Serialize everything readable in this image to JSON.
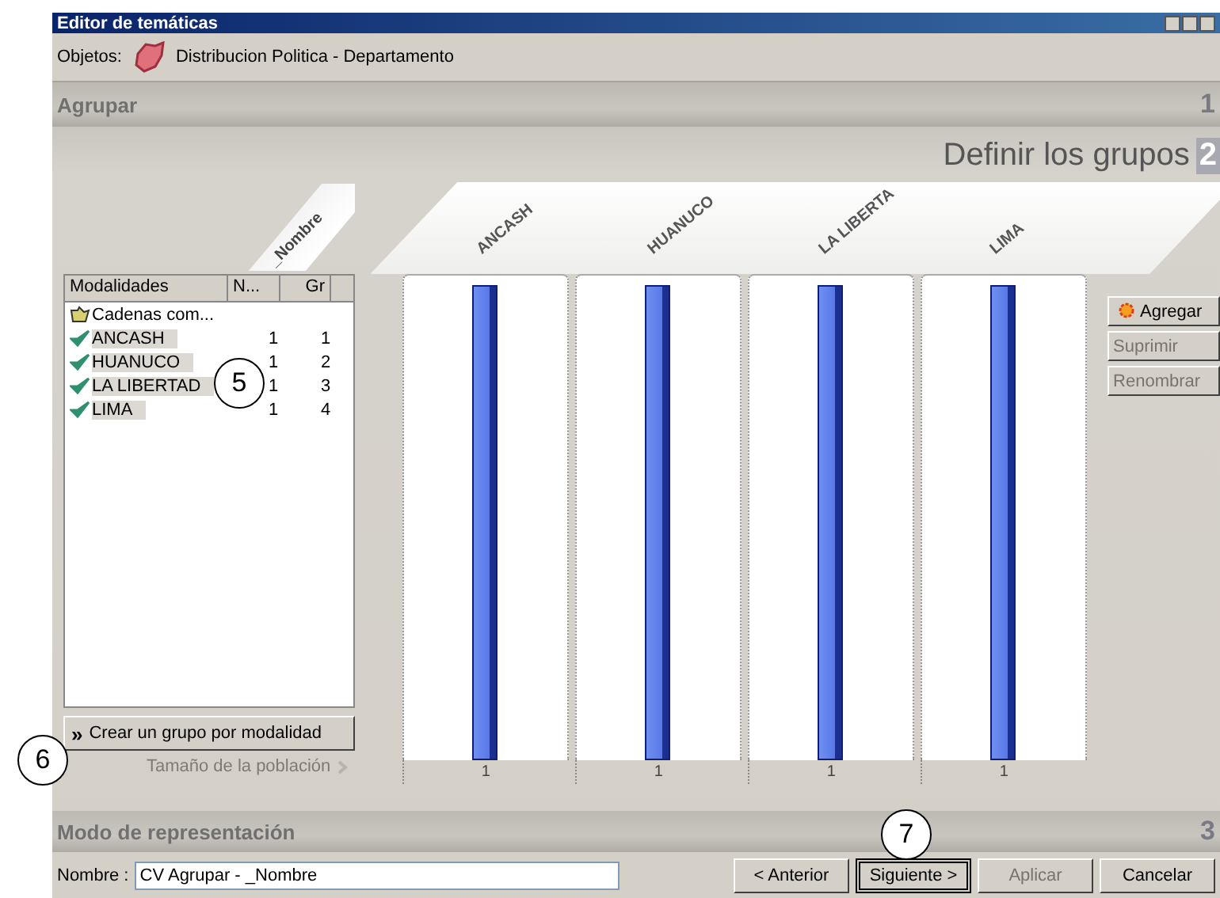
{
  "window": {
    "title": "Editor de temáticas"
  },
  "objects": {
    "label": "Objetos:",
    "value": "Distribucion Politica - Departamento"
  },
  "section_1": {
    "title": "Agrupar",
    "step": "1"
  },
  "step_2": {
    "title": "Definir los grupos",
    "step": "2"
  },
  "field_header": "_Nombre",
  "list": {
    "columns": [
      "Modalidades",
      "N...",
      "Gr"
    ],
    "group_row": "Cadenas com...",
    "rows": [
      {
        "name": "ANCASH",
        "n": "1",
        "gr": "1",
        "checked": true
      },
      {
        "name": "HUANUCO",
        "n": "1",
        "gr": "2",
        "checked": true
      },
      {
        "name": "LA LIBERTAD",
        "n": "1",
        "gr": "3",
        "checked": true
      },
      {
        "name": "LIMA",
        "n": "1",
        "gr": "4",
        "checked": true
      }
    ]
  },
  "groups": [
    {
      "name": "ANCASH",
      "count": "1",
      "level": 1
    },
    {
      "name": "HUANUCO",
      "count": "1",
      "level": 1
    },
    {
      "name": "LA LIBERTA",
      "count": "1",
      "level": 1
    },
    {
      "name": "LIMA",
      "count": "1",
      "level": 1
    }
  ],
  "side_buttons": [
    {
      "label": "Agregar",
      "disabled": false
    },
    {
      "label": "Suprimir",
      "disabled": true
    },
    {
      "label": "Renombrar",
      "disabled": true
    }
  ],
  "create_button": "Crear un grupo por modalidad",
  "create_icon": "»",
  "population_link": "Tamaño de la población",
  "section_3": {
    "title": "Modo de representación",
    "step": "3"
  },
  "name_field": {
    "label": "Nombre :",
    "value": "CV Agrupar - _Nombre"
  },
  "footer_buttons": [
    {
      "label": "< Anterior",
      "disabled": false,
      "focused": false
    },
    {
      "label": "Siguiente >",
      "disabled": false,
      "focused": true
    },
    {
      "label": "Aplicar",
      "disabled": true,
      "focused": false
    },
    {
      "label": "Cancelar",
      "disabled": false,
      "focused": false
    }
  ],
  "callouts": [
    "5",
    "6",
    "7"
  ]
}
